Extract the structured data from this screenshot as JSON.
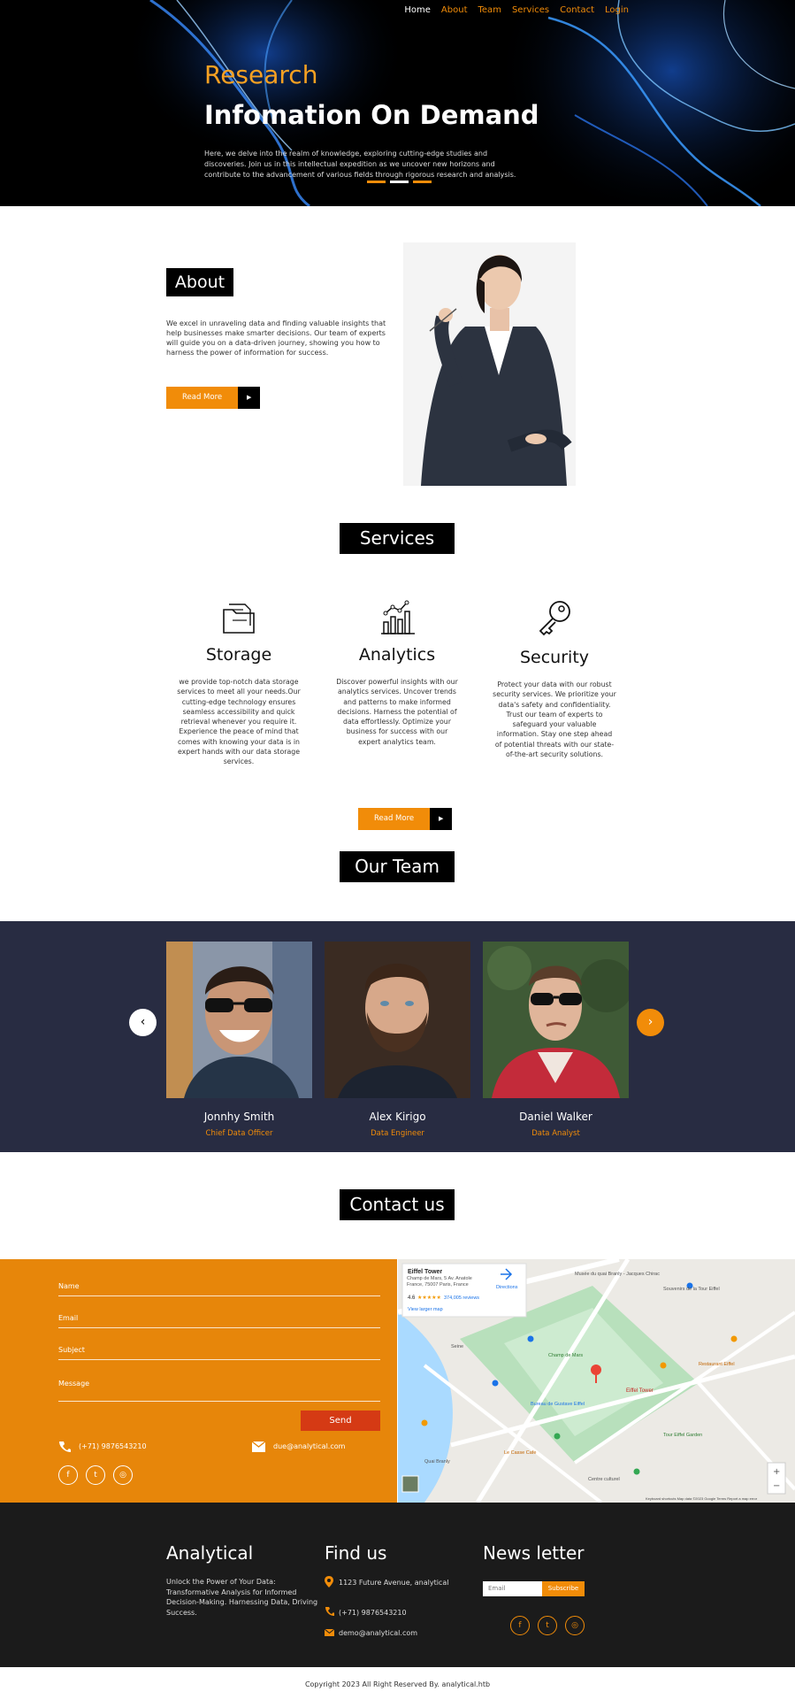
{
  "nav": {
    "home": "Home",
    "about": "About",
    "team": "Team",
    "services": "Services",
    "contact": "Contact",
    "login": "Login"
  },
  "hero": {
    "subtitle": "Research",
    "title": "Infomation On Demand",
    "text": "Here, we delve into the realm of knowledge, exploring cutting-edge studies and discoveries. Join us in this intellectual expedition as we uncover new horizons and contribute to the advancement of various fields through rigorous research and analysis."
  },
  "about": {
    "heading": "About",
    "text": "We excel in unraveling data and finding valuable insights that help businesses make smarter decisions. Our team of experts will guide you on a data-driven journey, showing you how to harness the power of information for success.",
    "button": "Read More"
  },
  "services": {
    "heading": "Services",
    "items": [
      {
        "title": "Storage",
        "icon": "folder-icon",
        "text": "we provide top-notch data storage services to meet all your needs.Our cutting-edge technology ensures seamless accessibility and quick retrieval whenever you require it. Experience the peace of mind that comes with knowing your data is in expert hands with our data storage services."
      },
      {
        "title": "Analytics",
        "icon": "chart-icon",
        "text": "Discover powerful insights with our analytics services. Uncover trends and patterns to make informed decisions. Harness the potential of data effortlessly. Optimize your business for success with our expert analytics team."
      },
      {
        "title": "Security",
        "icon": "key-icon",
        "text": "Protect your data with our robust security services. We prioritize your data's safety and confidentiality. Trust our team of experts to safeguard your valuable information. Stay one step ahead of potential threats with our state-of-the-art security solutions."
      }
    ],
    "button": "Read More"
  },
  "team": {
    "heading": "Our Team",
    "members": [
      {
        "name": "Jonnhy Smith",
        "role": "Chief Data Officer"
      },
      {
        "name": "Alex Kirigo",
        "role": "Data Engineer"
      },
      {
        "name": "Daniel Walker",
        "role": "Data Analyst"
      }
    ]
  },
  "contact": {
    "heading": "Contact us",
    "placeholders": {
      "name": "Name",
      "email": "Email",
      "subject": "Subject",
      "message": "Message"
    },
    "send": "Send",
    "phone": "(+71) 9876543210",
    "email": "due@analytical.com"
  },
  "map": {
    "place": "Eiffel Tower",
    "address": "Champ de Mars, 5 Av. Anatole France, 75007 Paris, France",
    "rating": "4.6",
    "reviews": "374,005 reviews",
    "directions": "Directions",
    "larger": "View larger map",
    "labels": [
      "Musée du quai Branly - Jacques Chirac",
      "Champ de Mars",
      "Eiffel Tower",
      "Parc du Champ de Mars",
      "Seine",
      "Souvenirs de la Tour Eiffel",
      "Restaurant Eiffel",
      "Bureau de Gustave Eiffel",
      "Le Casse Cafe",
      "Centre culturel",
      "Tour Eiffel Garden",
      "Avenue Anatole France",
      "Quai Branly",
      "Bateaux Parisiens"
    ],
    "attribution": "Keyboard shortcuts   Map data ©2023 Google   Terms   Report a map error"
  },
  "footer": {
    "brand": "Analytical",
    "brand_text": "Unlock the Power of Your Data: Transformative Analysis for Informed Decision-Making. Harnessing Data, Driving Success.",
    "find_heading": "Find us",
    "address": "1123 Future Avenue, analytical",
    "phone": "(+71) 9876543210",
    "email": "demo@analytical.com",
    "news_heading": "News letter",
    "email_placeholder": "Email",
    "subscribe": "Subscribe",
    "copyright": "Copyright 2023 All Right Reserved By. analytical.htb"
  },
  "colors": {
    "accent": "#f18c09",
    "dark": "#282c42",
    "send": "#d53a14",
    "footer": "#1b1b1b"
  }
}
